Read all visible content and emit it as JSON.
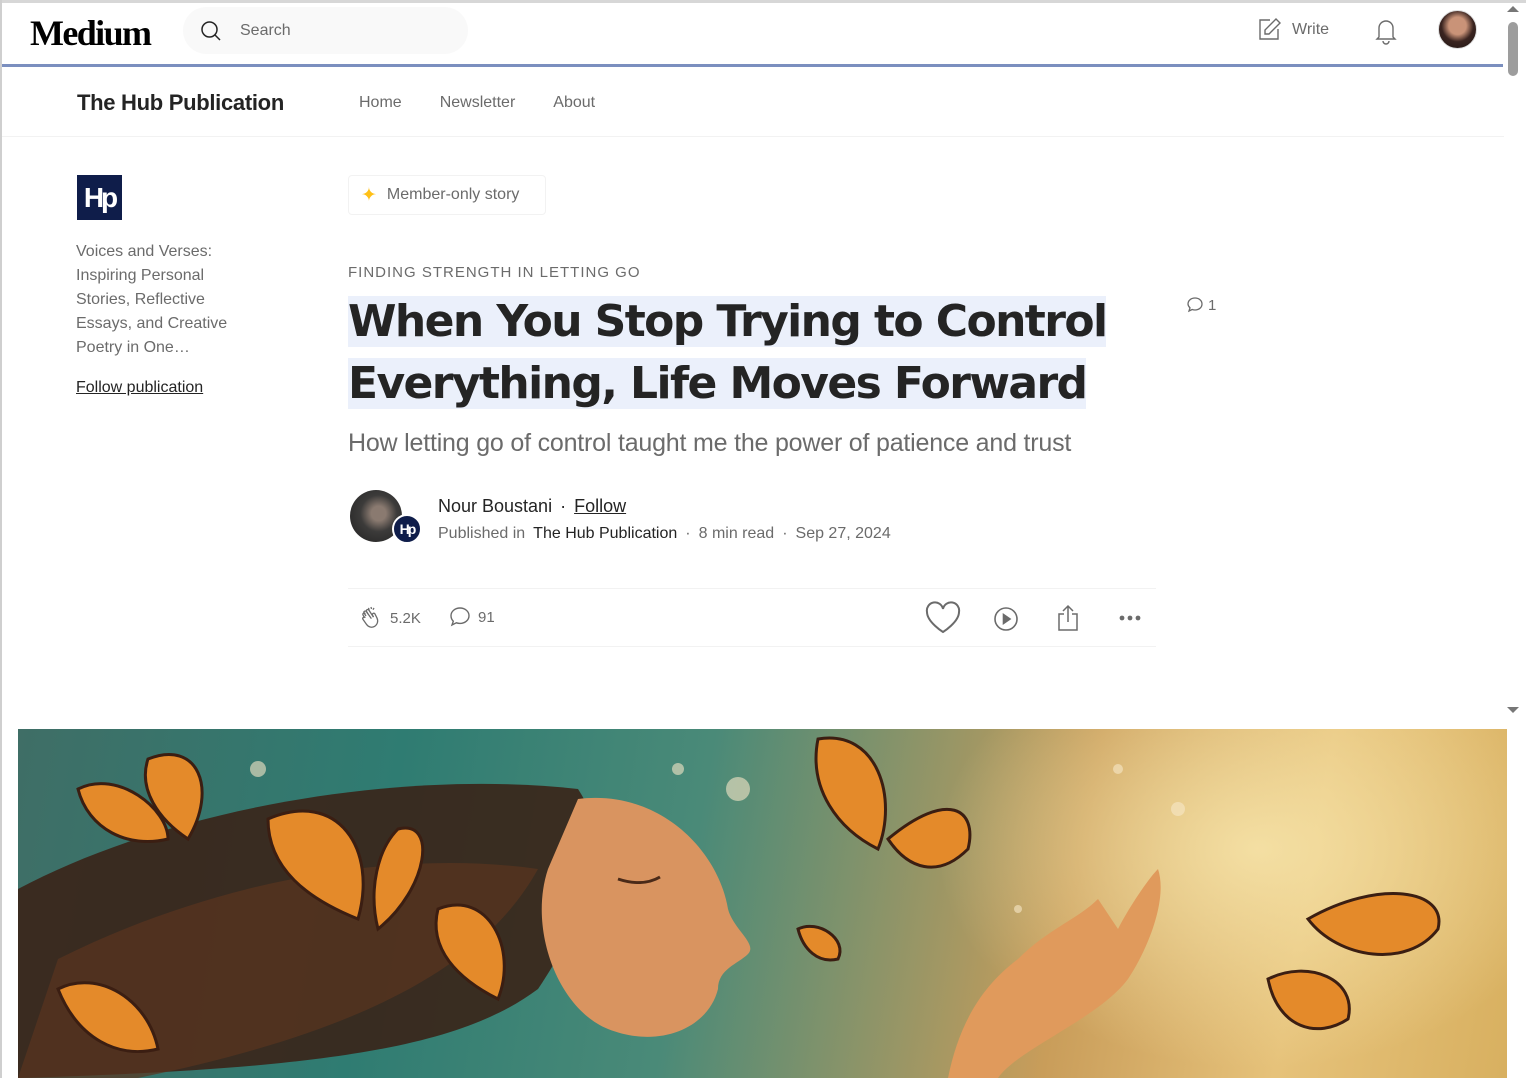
{
  "topnav": {
    "logo": "Medium",
    "search_placeholder": "Search",
    "write_label": "Write"
  },
  "publication": {
    "name": "The Hub Publication",
    "links": [
      "Home",
      "Newsletter",
      "About"
    ],
    "logo_text": "Hp",
    "description": "Voices and Verses: Inspiring Personal Stories, Reflective Essays, and Creative Poetry in One…",
    "follow_label": "Follow publication"
  },
  "article": {
    "member_badge": "Member-only story",
    "kicker": "FINDING STRENGTH IN LETTING GO",
    "title": "When You Stop Trying to Control Everything, Life Moves Forward",
    "title_line1": "When You Stop Trying to Control",
    "title_line2": "Everything, Life Moves Forward",
    "side_comment_count": "1",
    "subtitle": "How letting go of control taught me the power of patience and trust",
    "author": "Nour Boustani",
    "follow_label": "Follow",
    "published_in_label": "Published in",
    "publication": "The Hub Publication",
    "read_time": "8 min read",
    "date": "Sep 27, 2024",
    "claps": "5.2K",
    "responses": "91"
  },
  "colors": {
    "accent_underline": "#7b8fbf",
    "member_star": "#ffc017",
    "publication_logo_bg": "#0f1d4a",
    "title_highlight": "#ebf0fb"
  },
  "icons": [
    "search-icon",
    "write-icon",
    "bell-icon",
    "clap-icon",
    "comment-icon",
    "heart-icon",
    "play-icon",
    "share-icon",
    "more-icon"
  ]
}
